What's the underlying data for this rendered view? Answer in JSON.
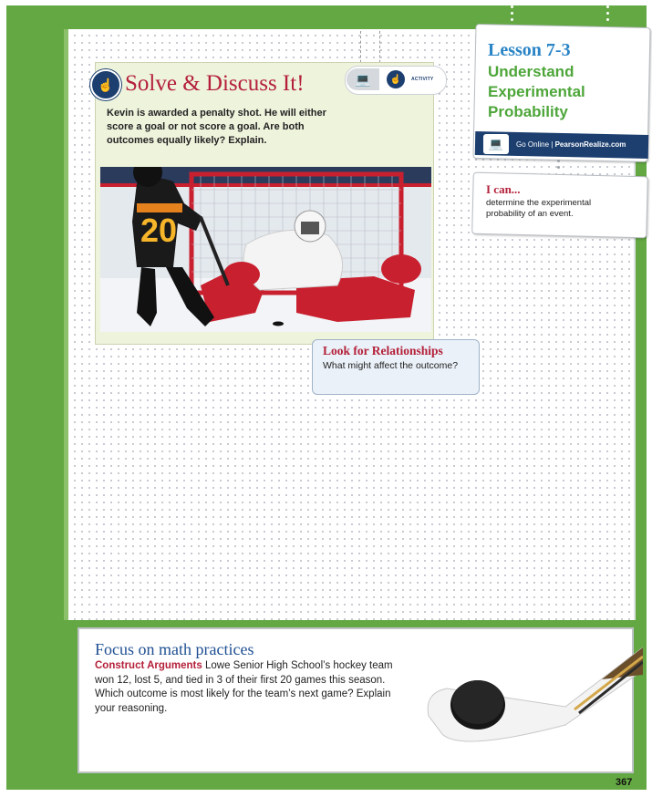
{
  "solve": {
    "title": "Solve & Discuss It!",
    "body": "Kevin is awarded a penalty shot. He will either score a goal or not score a goal. Are both outcomes equally likely? Explain.",
    "activity_label": "ACTIVITY"
  },
  "look": {
    "title": "Look for Relationships",
    "text": "What might affect the outcome?"
  },
  "lesson": {
    "number": "Lesson 7-3",
    "title": "Understand Experimental Probability",
    "online_text": "Go Online",
    "online_site": "PearsonRealize.com"
  },
  "ican": {
    "title": "I can...",
    "text": "determine the experimental probability of an event."
  },
  "focus": {
    "title": "Focus on math practices",
    "lead": "Construct Arguments",
    "text": "Lowe Senior High School’s hockey team won 12, lost 5, and tied in 3 of their first 20 games this season. Which outcome is most likely for the team’s next game? Explain your reasoning."
  },
  "photo": {
    "jersey_number": "20"
  },
  "page_number": "367",
  "colors": {
    "green": "#63a842",
    "red": "#b4203a",
    "navy": "#1c3f70",
    "blue": "#2a84c6"
  }
}
